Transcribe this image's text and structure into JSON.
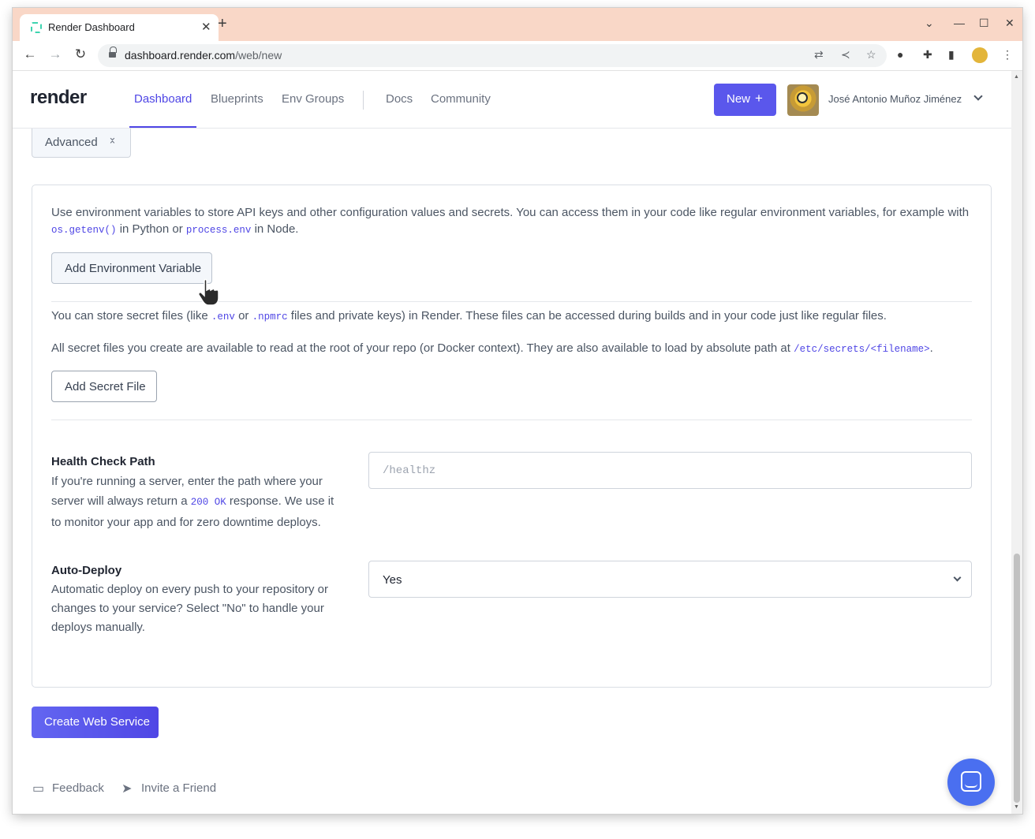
{
  "browser": {
    "tab_title": "Render Dashboard",
    "tab_close": "✕",
    "new_tab": "+",
    "url_host": "dashboard.render.com",
    "url_path": "/web/new",
    "window_controls": [
      "⌄",
      "—",
      "☐",
      "✕"
    ]
  },
  "header": {
    "logo": "render",
    "nav": [
      "Dashboard",
      "Blueprints",
      "Env Groups",
      "Docs",
      "Community"
    ],
    "active_nav": "Dashboard",
    "new_button": "New",
    "new_button_plus": "+",
    "user_name": "José Antonio Muñoz Jiménez"
  },
  "advanced": {
    "label": "Advanced"
  },
  "env": {
    "desc_prefix": "Use environment variables to store API keys and other configuration values and secrets. You can access them in your code like regular environment variables, for example with",
    "code_python": "os.getenv()",
    "mid_text": "in Python or",
    "code_node": "process.env",
    "suffix_text": "in Node.",
    "add_button": "Add Environment Variable"
  },
  "secrets": {
    "p1_prefix": "You can store secret files (like",
    "p1_code1": ".env",
    "p1_or": "or",
    "p1_code2": ".npmrc",
    "p1_suffix": "files and private keys) in Render. These files can be accessed during builds and in your code just like regular files.",
    "p2_prefix": "All secret files you create are available to read at the root of your repo (or Docker context). They are also available to load by absolute path at",
    "p2_code": "/etc/secrets/<filename>",
    "p2_suffix": ".",
    "add_button": "Add Secret File"
  },
  "health_check": {
    "title": "Health Check Path",
    "desc_prefix": "If you're running a server, enter the path where your server will always return a",
    "desc_code": "200 OK",
    "desc_suffix": "response. We use it to monitor your app and for zero downtime deploys.",
    "placeholder": "/healthz",
    "value": ""
  },
  "auto_deploy": {
    "title": "Auto-Deploy",
    "desc": "Automatic deploy on every push to your repository or changes to your service? Select \"No\" to handle your deploys manually.",
    "selected": "Yes"
  },
  "create_button": "Create Web Service",
  "footer": {
    "feedback": "Feedback",
    "invite": "Invite a Friend"
  },
  "colors": {
    "accent": "#4f46e5",
    "tab_bar": "#f9d7c7",
    "chat": "#4a6ff0"
  }
}
